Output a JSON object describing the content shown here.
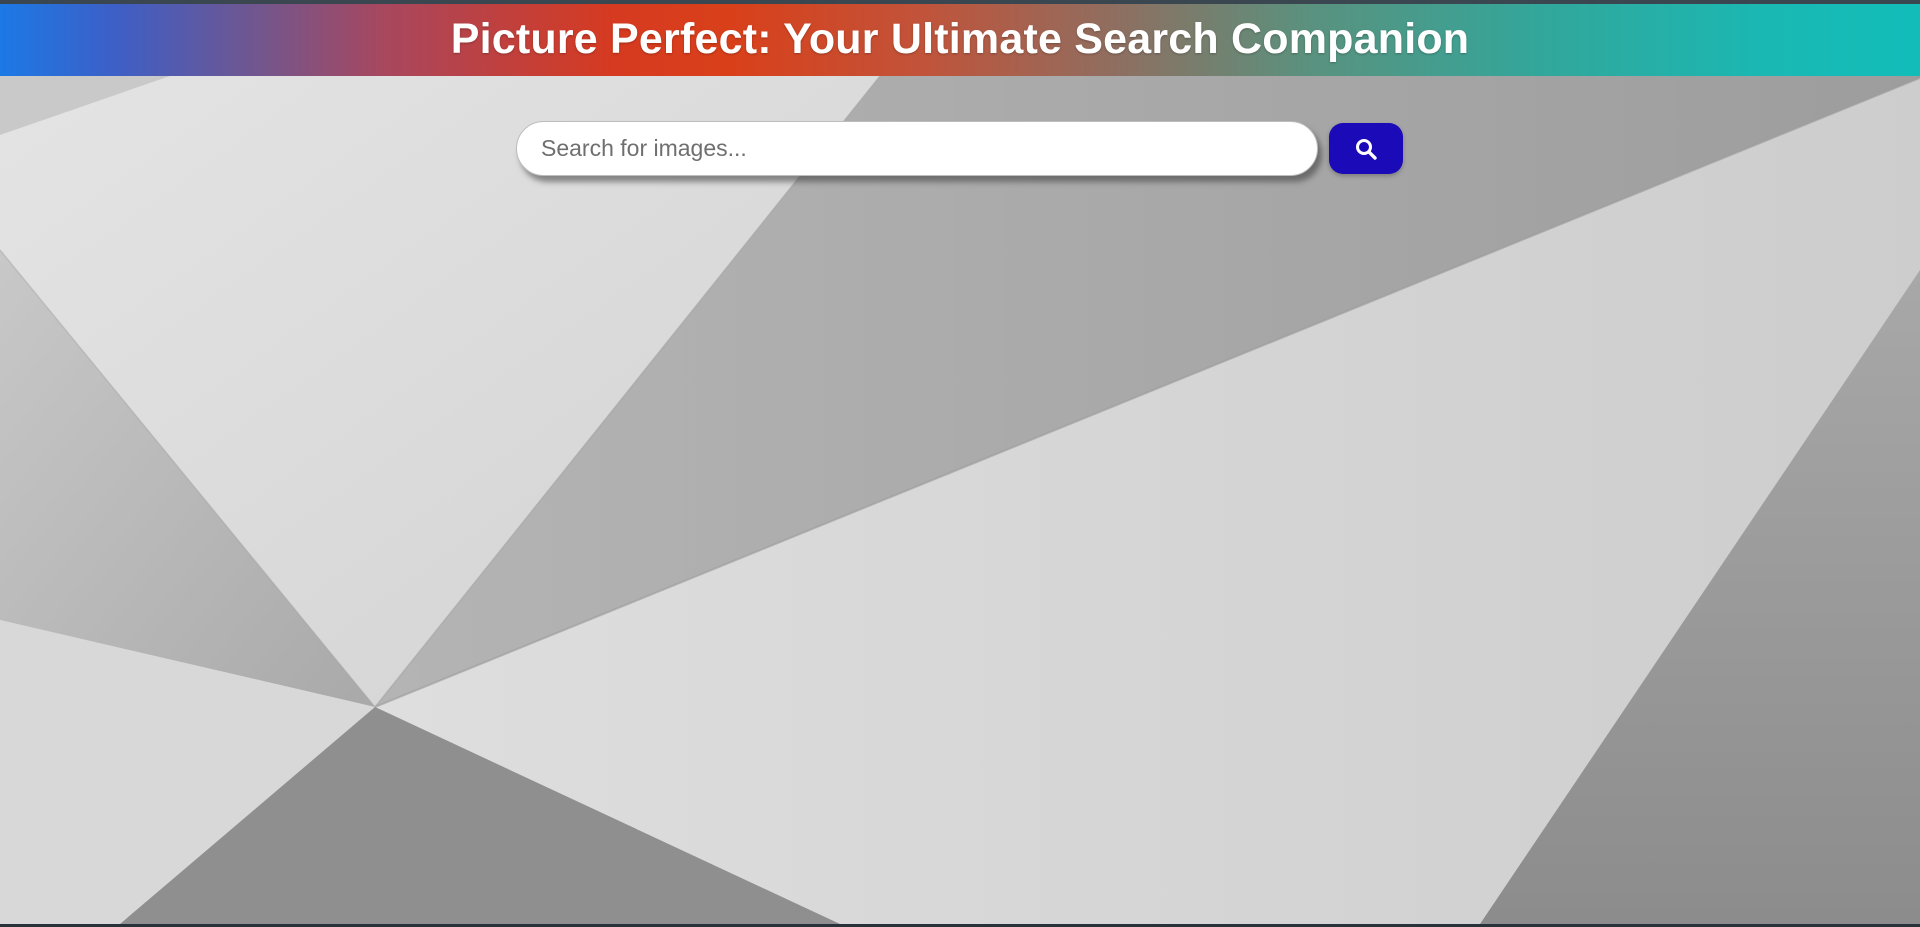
{
  "header": {
    "title": "Picture Perfect: Your Ultimate Search Companion"
  },
  "search": {
    "placeholder": "Search for images...",
    "value": "",
    "button_icon": "search-icon"
  },
  "colors": {
    "search_button": "#1a0ab8",
    "header_gradient_start": "#1c79e6",
    "header_gradient_mid": "#d63a20",
    "header_gradient_end": "#12bdb9"
  }
}
